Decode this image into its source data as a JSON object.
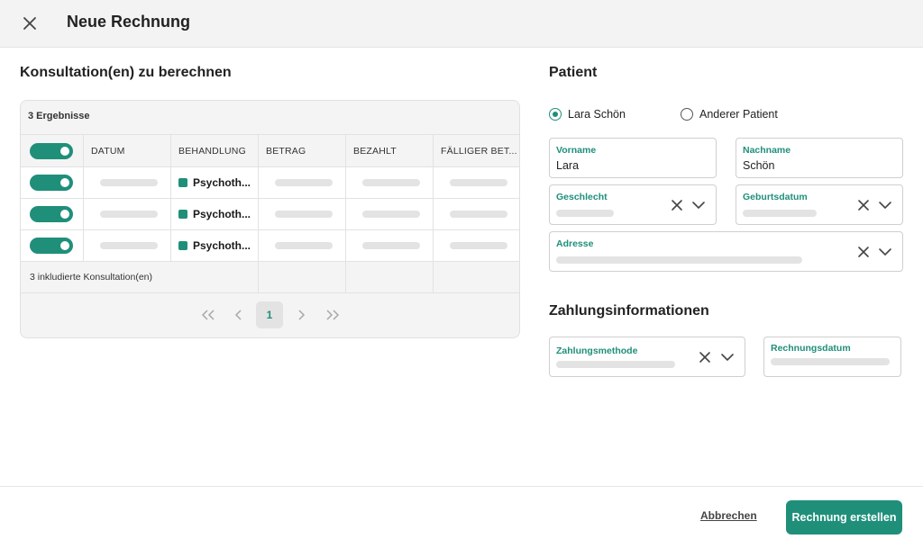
{
  "header": {
    "title": "Neue Rechnung",
    "close_icon": "close-icon"
  },
  "consultations": {
    "title": "Konsultation(en) zu berechnen",
    "results_count": "3 Ergebnisse",
    "columns": [
      "DATUM",
      "BEHANDLUNG",
      "BETRAG",
      "BEZAHLT",
      "FÄLLIGER BET..."
    ],
    "rows": [
      {
        "selected": true,
        "treatment": "Psychoth..."
      },
      {
        "selected": true,
        "treatment": "Psychoth..."
      },
      {
        "selected": true,
        "treatment": "Psychoth..."
      }
    ],
    "footer_text": "3 inkludierte Konsultation(en)",
    "pagination": {
      "first": "«",
      "prev": "‹",
      "page": "1",
      "next": "›",
      "last": "»"
    },
    "accent_color": "#1f8f7a"
  },
  "patient": {
    "title": "Patient",
    "options": [
      "Lara Schön",
      "Anderer Patient"
    ],
    "selected_option": "Lara Schön",
    "fields": {
      "first_name": {
        "label": "Vorname",
        "value": "Lara"
      },
      "last_name": {
        "label": "Nachname",
        "value": "Schön"
      },
      "gender": {
        "label": "Geschlecht"
      },
      "birthdate": {
        "label": "Geburtsdatum"
      },
      "address": {
        "label": "Adresse"
      }
    }
  },
  "payment": {
    "title": "Zahlungsinformationen",
    "fields": {
      "method": {
        "label": "Zahlungsmethode"
      },
      "invoice_date": {
        "label": "Rechnungsdatum"
      }
    }
  },
  "actions": {
    "cancel": "Abbrechen",
    "create": "Rechnung erstellen"
  }
}
